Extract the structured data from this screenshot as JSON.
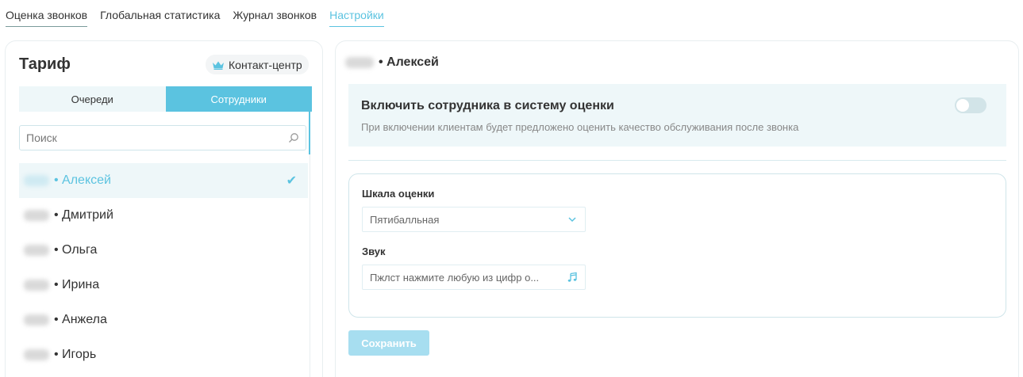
{
  "nav": {
    "tabs": [
      {
        "label": "Оценка звонков"
      },
      {
        "label": "Глобальная статистика"
      },
      {
        "label": "Журнал звонков"
      },
      {
        "label": "Настройки"
      }
    ]
  },
  "left": {
    "title": "Тариф",
    "plan_badge": "Контакт-центр",
    "segments": {
      "queues": "Очереди",
      "employees": "Сотрудники"
    },
    "search_placeholder": "Поиск",
    "employees": [
      {
        "name": "• Алексей",
        "selected": true
      },
      {
        "name": "• Дмитрий"
      },
      {
        "name": "• Ольга"
      },
      {
        "name": "• Ирина"
      },
      {
        "name": "• Анжела"
      },
      {
        "name": "• Игорь"
      }
    ],
    "check_mark": "✔"
  },
  "right": {
    "employee_title": "• Алексей",
    "toggle_title": "Включить сотрудника в систему оценки",
    "toggle_desc": "При включении клиентам будет предложено оценить качество обслуживания после звонка",
    "toggle_on": false,
    "scale_label": "Шкала оценки",
    "scale_value": "Пятибалльная",
    "sound_label": "Звук",
    "sound_value": "Пжлст нажмите любую из цифр о...",
    "save_label": "Сохранить"
  },
  "colors": {
    "accent": "#5bc3e0",
    "accent_light": "#eef7f9",
    "save_disabled": "#a7def0"
  },
  "icons": [
    "crown-icon",
    "search-icon",
    "check-icon",
    "chevron-down-icon",
    "music-note-icon"
  ]
}
